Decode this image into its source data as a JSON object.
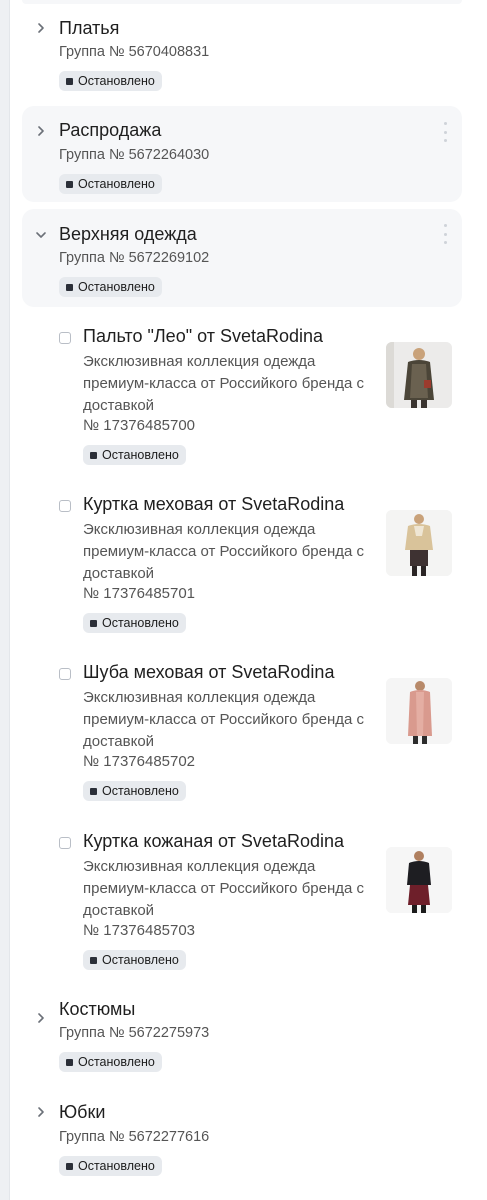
{
  "status_label": "Остановлено",
  "groups_top": [
    {
      "title": "Платья",
      "group_id": "Группа № 5670408831",
      "expanded": false
    },
    {
      "title": "Распродажа",
      "group_id": "Группа № 5672264030",
      "expanded": false
    },
    {
      "title": "Верхняя одежда",
      "group_id": "Группа № 5672269102",
      "expanded": true
    }
  ],
  "ads": [
    {
      "title": "Пальто \"Лео\" от SvetaRodina",
      "description": "Эксклюзивная коллекция одежда премиум-класса от Российкого бренда с доставкой",
      "number": "№ 17376485700",
      "status": "Остановлено",
      "thumbnail": "coat-photo"
    },
    {
      "title": "Куртка меховая от SvetaRodina",
      "description": "Эксклюзивная коллекция одежда премиум-класса от Российкого бренда с доставкой",
      "number": "№ 17376485701",
      "status": "Остановлено",
      "thumbnail": "fur-jacket-photo"
    },
    {
      "title": "Шуба меховая от SvetaRodina",
      "description": "Эксклюзивная коллекция одежда премиум-класса от Российкого бренда с доставкой",
      "number": "№ 17376485702",
      "status": "Остановлено",
      "thumbnail": "fur-coat-photo"
    },
    {
      "title": "Куртка кожаная от SvetaRodina",
      "description": "Эксклюзивная коллекция одежда премиум-класса от Российкого бренда с доставкой",
      "number": "№ 17376485703",
      "status": "Остановлено",
      "thumbnail": "leather-jacket-photo"
    }
  ],
  "groups_bottom": [
    {
      "title": "Костюмы",
      "group_id": "Группа № 5672275973",
      "expanded": false
    },
    {
      "title": "Юбки",
      "group_id": "Группа № 5672277616",
      "expanded": false
    }
  ],
  "colors": {
    "status_square": "#2b2f38",
    "badge_bg": "#e7eaee",
    "card_bg": "#f6f7f9"
  }
}
